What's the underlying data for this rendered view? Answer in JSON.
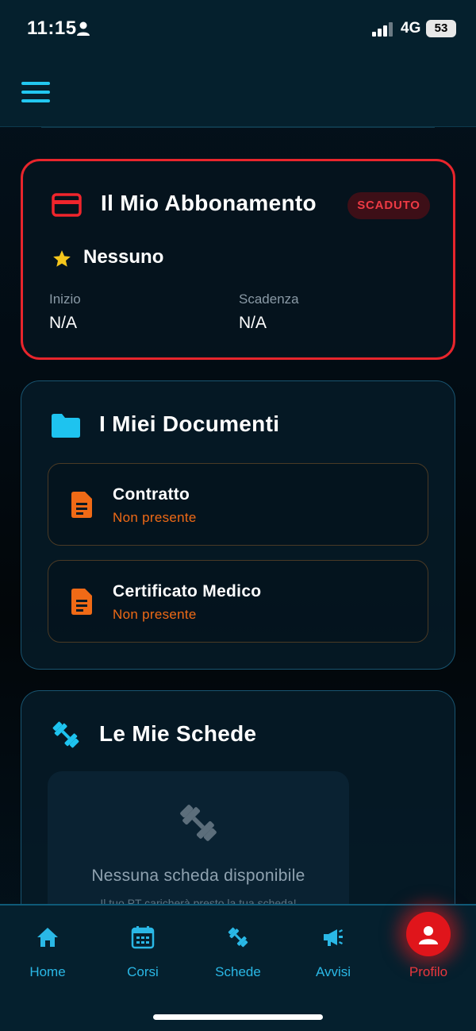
{
  "status_bar": {
    "time": "11:15",
    "network": "4G",
    "battery": "53"
  },
  "subscription": {
    "title": "Il Mio Abbonamento",
    "badge": "SCADUTO",
    "plan": "Nessuno",
    "start_label": "Inizio",
    "start_value": "N/A",
    "end_label": "Scadenza",
    "end_value": "N/A",
    "colors": {
      "border": "#e8252c",
      "badge_text": "#ee3a44"
    }
  },
  "documents": {
    "title": "I Miei Documenti",
    "items": [
      {
        "title": "Contratto",
        "status": "Non presente"
      },
      {
        "title": "Certificato Medico",
        "status": "Non presente"
      }
    ],
    "colors": {
      "status": "#f06a16",
      "icon": "#f06a16"
    }
  },
  "plans": {
    "title": "Le Mie Schede",
    "empty_text": "Nessuna scheda disponibile",
    "empty_subtext": "Il tuo PT caricherà presto la tua scheda!"
  },
  "tabbar": {
    "items": [
      {
        "label": "Home",
        "icon": "home-icon"
      },
      {
        "label": "Corsi",
        "icon": "calendar-icon"
      },
      {
        "label": "Schede",
        "icon": "dumbbell-icon"
      },
      {
        "label": "Avvisi",
        "icon": "megaphone-icon"
      },
      {
        "label": "Profilo",
        "icon": "user-icon"
      }
    ],
    "active": "Profilo",
    "colors": {
      "accent": "#2ab8e6",
      "active": "#e8373d"
    }
  }
}
